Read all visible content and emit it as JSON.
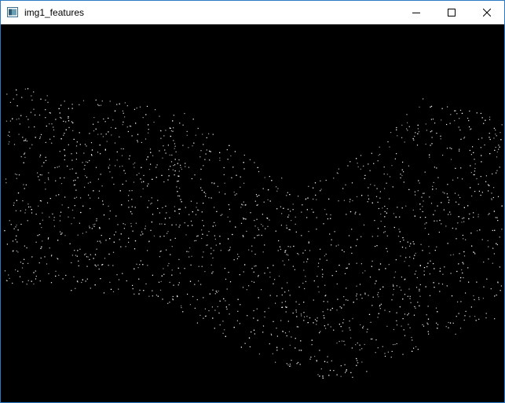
{
  "window": {
    "title": "img1_features",
    "icon": "app-window-icon",
    "controls": {
      "minimize_icon": "minimize-icon",
      "maximize_icon": "maximize-icon",
      "close_icon": "close-icon"
    }
  },
  "canvas": {
    "background": "#000000",
    "point_color": "#ffffff"
  }
}
